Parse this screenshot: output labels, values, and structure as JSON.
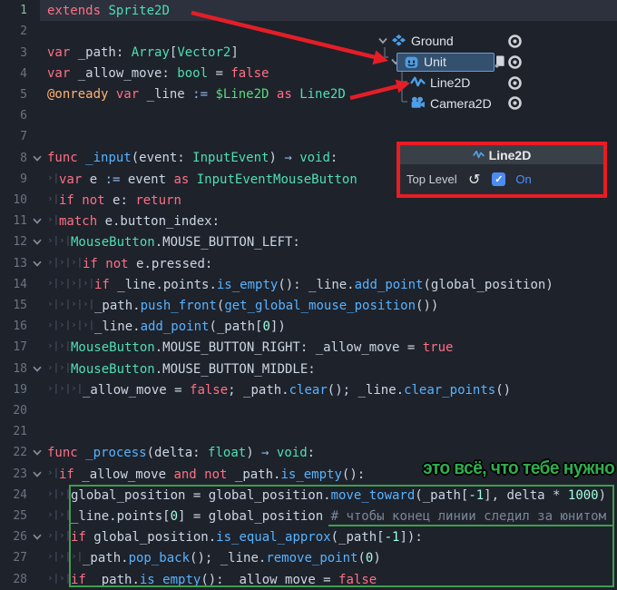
{
  "colors": {
    "arrow_red": "#e41e26",
    "callout_green": "#2fae4e",
    "accent_blue": "#4c8cf2",
    "type_teal": "#4edfb2",
    "keyword_red": "#ff7085",
    "function_blue": "#57b3ff"
  },
  "editor": {
    "lines": [
      {
        "n": "1",
        "hl": true,
        "indent": 0,
        "fold": false,
        "tokens": [
          [
            "kw",
            "extends "
          ],
          [
            "type",
            "Sprite2D"
          ]
        ]
      },
      {
        "n": "2",
        "indent": 0,
        "fold": false,
        "tokens": []
      },
      {
        "n": "3",
        "indent": 0,
        "fold": false,
        "tokens": [
          [
            "kw",
            "var "
          ],
          [
            "txt",
            "_path: "
          ],
          [
            "type",
            "Array"
          ],
          [
            "txt",
            "["
          ],
          [
            "type",
            "Vector2"
          ],
          [
            "txt",
            "]"
          ]
        ]
      },
      {
        "n": "4",
        "indent": 0,
        "fold": false,
        "tokens": [
          [
            "kw",
            "var "
          ],
          [
            "txt",
            "_allow_move: "
          ],
          [
            "type",
            "bool"
          ],
          [
            "txt",
            " = "
          ],
          [
            "kw",
            "false"
          ]
        ]
      },
      {
        "n": "5",
        "indent": 0,
        "fold": false,
        "tokens": [
          [
            "ann",
            "@onready "
          ],
          [
            "kw",
            "var "
          ],
          [
            "txt",
            "_line "
          ],
          [
            "op",
            ":= "
          ],
          [
            "path",
            "$Line2D "
          ],
          [
            "kw",
            "as "
          ],
          [
            "type",
            "Line2D"
          ]
        ]
      },
      {
        "n": "6",
        "indent": 0,
        "fold": false,
        "tokens": []
      },
      {
        "n": "7",
        "indent": 0,
        "fold": false,
        "tokens": []
      },
      {
        "n": "8",
        "indent": 0,
        "fold": true,
        "tokens": [
          [
            "kw",
            "func "
          ],
          [
            "fn",
            "_input"
          ],
          [
            "txt",
            "(event: "
          ],
          [
            "type",
            "InputEvent"
          ],
          [
            "txt",
            ") "
          ],
          [
            "op",
            "→ "
          ],
          [
            "type",
            "void"
          ],
          [
            "txt",
            ":"
          ]
        ]
      },
      {
        "n": "9",
        "indent": 1,
        "fold": false,
        "tokens": [
          [
            "kw",
            "var "
          ],
          [
            "txt",
            "e "
          ],
          [
            "op",
            ":= "
          ],
          [
            "txt",
            "event "
          ],
          [
            "kw",
            "as "
          ],
          [
            "type",
            "InputEventMouseButton"
          ]
        ]
      },
      {
        "n": "10",
        "indent": 1,
        "fold": false,
        "tokens": [
          [
            "kw",
            "if not "
          ],
          [
            "txt",
            "e: "
          ],
          [
            "kw",
            "return"
          ]
        ]
      },
      {
        "n": "11",
        "indent": 1,
        "fold": true,
        "tokens": [
          [
            "kw",
            "match "
          ],
          [
            "txt",
            "e.button_index:"
          ]
        ]
      },
      {
        "n": "12",
        "indent": 2,
        "fold": true,
        "tokens": [
          [
            "type",
            "MouseButton"
          ],
          [
            "txt",
            ".MOUSE_BUTTON_LEFT:"
          ]
        ]
      },
      {
        "n": "13",
        "indent": 3,
        "fold": true,
        "tokens": [
          [
            "kw",
            "if not "
          ],
          [
            "txt",
            "e.pressed:"
          ]
        ]
      },
      {
        "n": "14",
        "indent": 4,
        "fold": false,
        "tokens": [
          [
            "kw",
            "if "
          ],
          [
            "txt",
            "_line.points."
          ],
          [
            "fn",
            "is_empty"
          ],
          [
            "txt",
            "(): _line."
          ],
          [
            "fn",
            "add_point"
          ],
          [
            "txt",
            "(global_position)"
          ]
        ]
      },
      {
        "n": "15",
        "indent": 4,
        "fold": false,
        "tokens": [
          [
            "txt",
            "_path."
          ],
          [
            "fn",
            "push_front"
          ],
          [
            "txt",
            "("
          ],
          [
            "fn",
            "get_global_mouse_position"
          ],
          [
            "txt",
            "())"
          ]
        ]
      },
      {
        "n": "16",
        "indent": 4,
        "fold": false,
        "tokens": [
          [
            "txt",
            "_line."
          ],
          [
            "fn",
            "add_point"
          ],
          [
            "txt",
            "(_path["
          ],
          [
            "num",
            "0"
          ],
          [
            "txt",
            "])"
          ]
        ]
      },
      {
        "n": "17",
        "indent": 2,
        "fold": false,
        "tokens": [
          [
            "type",
            "MouseButton"
          ],
          [
            "txt",
            ".MOUSE_BUTTON_RIGHT: _allow_move = "
          ],
          [
            "kw",
            "true"
          ]
        ]
      },
      {
        "n": "18",
        "indent": 2,
        "fold": true,
        "tokens": [
          [
            "type",
            "MouseButton"
          ],
          [
            "txt",
            ".MOUSE_BUTTON_MIDDLE:"
          ]
        ]
      },
      {
        "n": "19",
        "indent": 3,
        "fold": false,
        "tokens": [
          [
            "txt",
            "_allow_move = "
          ],
          [
            "kw",
            "false"
          ],
          [
            "txt",
            "; _path."
          ],
          [
            "fn",
            "clear"
          ],
          [
            "txt",
            "(); _line."
          ],
          [
            "fn",
            "clear_points"
          ],
          [
            "txt",
            "()"
          ]
        ]
      },
      {
        "n": "20",
        "indent": 0,
        "fold": false,
        "tokens": []
      },
      {
        "n": "21",
        "indent": 0,
        "fold": false,
        "tokens": []
      },
      {
        "n": "22",
        "indent": 0,
        "fold": true,
        "tokens": [
          [
            "kw",
            "func "
          ],
          [
            "fn",
            "_process"
          ],
          [
            "txt",
            "(delta: "
          ],
          [
            "type",
            "float"
          ],
          [
            "txt",
            ") "
          ],
          [
            "op",
            "→ "
          ],
          [
            "type",
            "void"
          ],
          [
            "txt",
            ":"
          ]
        ]
      },
      {
        "n": "23",
        "indent": 1,
        "fold": true,
        "tokens": [
          [
            "kw",
            "if "
          ],
          [
            "txt",
            "_allow_move "
          ],
          [
            "kw",
            "and not "
          ],
          [
            "txt",
            "_path."
          ],
          [
            "fn",
            "is_empty"
          ],
          [
            "txt",
            "():"
          ]
        ]
      },
      {
        "n": "24",
        "indent": 2,
        "fold": false,
        "tokens": [
          [
            "txt",
            "global_position = global_position."
          ],
          [
            "fn",
            "move_toward"
          ],
          [
            "txt",
            "(_path["
          ],
          [
            "num",
            "-1"
          ],
          [
            "txt",
            "], delta * "
          ],
          [
            "num",
            "1000"
          ],
          [
            "txt",
            ")"
          ]
        ]
      },
      {
        "n": "25",
        "indent": 2,
        "fold": false,
        "tokens": [
          [
            "txt",
            "_line.points["
          ],
          [
            "num",
            "0"
          ],
          [
            "txt",
            "] = global_position "
          ],
          [
            "cmt",
            "# чтобы конец линии следил за юнитом"
          ]
        ]
      },
      {
        "n": "26",
        "indent": 2,
        "fold": true,
        "tokens": [
          [
            "kw",
            "if "
          ],
          [
            "txt",
            "global_position."
          ],
          [
            "fn",
            "is_equal_approx"
          ],
          [
            "txt",
            "(_path["
          ],
          [
            "num",
            "-1"
          ],
          [
            "txt",
            "]):"
          ]
        ]
      },
      {
        "n": "27",
        "indent": 3,
        "fold": false,
        "tokens": [
          [
            "txt",
            "_path."
          ],
          [
            "fn",
            "pop_back"
          ],
          [
            "txt",
            "(); _line."
          ],
          [
            "fn",
            "remove_point"
          ],
          [
            "txt",
            "("
          ],
          [
            "num",
            "0"
          ],
          [
            "txt",
            ")"
          ]
        ]
      },
      {
        "n": "28",
        "indent": 2,
        "fold": false,
        "tokens": [
          [
            "kw",
            "if "
          ],
          [
            "txt",
            "_path."
          ],
          [
            "fn",
            "is_empty"
          ],
          [
            "txt",
            "(): _allow_move = "
          ],
          [
            "kw",
            "false"
          ]
        ]
      }
    ]
  },
  "scene_tree": {
    "nodes": [
      {
        "name": "Ground",
        "icon": "tilemap-icon",
        "depth": 0,
        "expanded": true,
        "selected": false,
        "has_script": false,
        "visible": true
      },
      {
        "name": "Unit",
        "icon": "godot-sprite-icon",
        "depth": 1,
        "expanded": true,
        "selected": true,
        "has_script": true,
        "visible": true
      },
      {
        "name": "Line2D",
        "icon": "line2d-icon",
        "depth": 2,
        "expanded": false,
        "selected": false,
        "has_script": false,
        "visible": true
      },
      {
        "name": "Camera2D",
        "icon": "camera2d-icon",
        "depth": 2,
        "expanded": false,
        "selected": false,
        "has_script": false,
        "visible": true
      }
    ]
  },
  "inspector": {
    "title": "Line2D",
    "property_label": "Top Level",
    "checked": true,
    "value_label": "On"
  },
  "annotations": {
    "callout_text": "это всё, что тебе нужно"
  }
}
